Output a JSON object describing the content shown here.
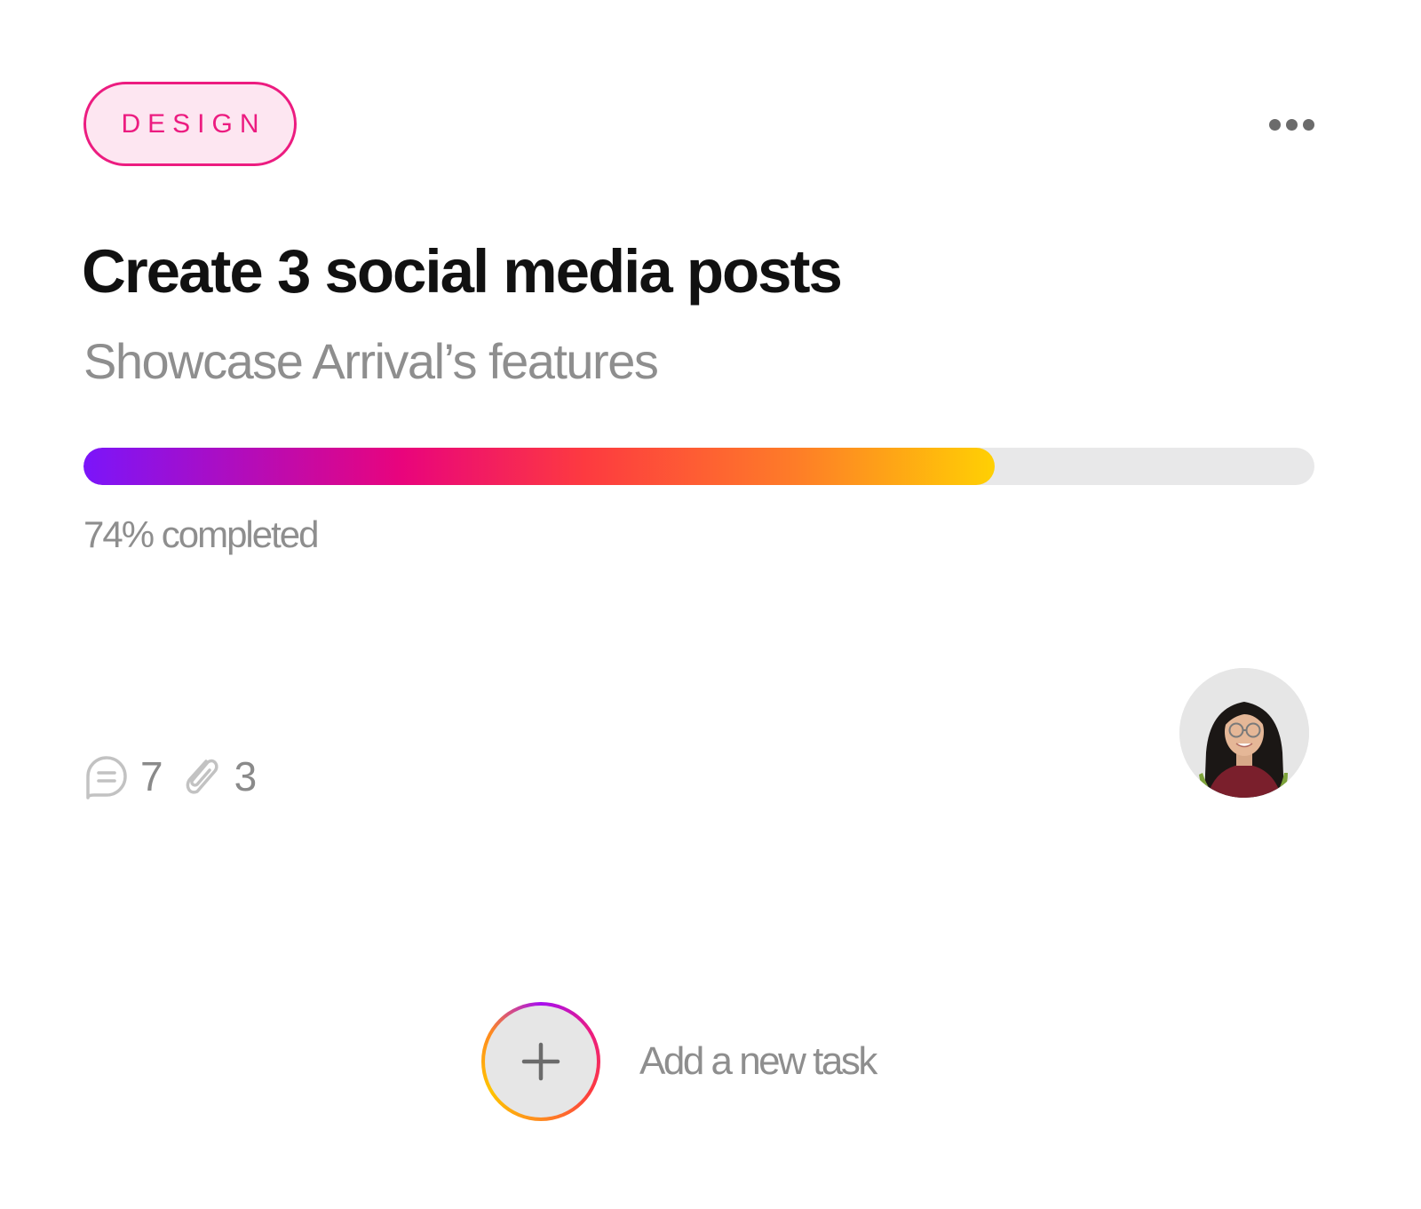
{
  "card": {
    "tag": "DESIGN",
    "more_icon": "more-horizontal-icon",
    "title": "Create 3 social media posts",
    "subtitle": "Showcase Arrival’s features",
    "progress": {
      "percent": 74,
      "label": "74% completed"
    },
    "comments": {
      "icon": "comment-bubble-icon",
      "count": "7"
    },
    "attachments": {
      "icon": "paperclip-icon",
      "count": "3"
    },
    "assignee": {
      "icon": "avatar"
    }
  },
  "add_task": {
    "icon": "plus-icon",
    "label": "Add a new task"
  },
  "colors": {
    "tag_accent": "#ec1c80",
    "tag_background": "#fde6f1",
    "title": "#111111",
    "muted_text": "#8e8e8e",
    "progress_track": "#e8e8e9",
    "progress_gradient": [
      "#7b15fa",
      "#e9047c",
      "#fd3a40",
      "#fe7c28",
      "#ffd003"
    ]
  }
}
